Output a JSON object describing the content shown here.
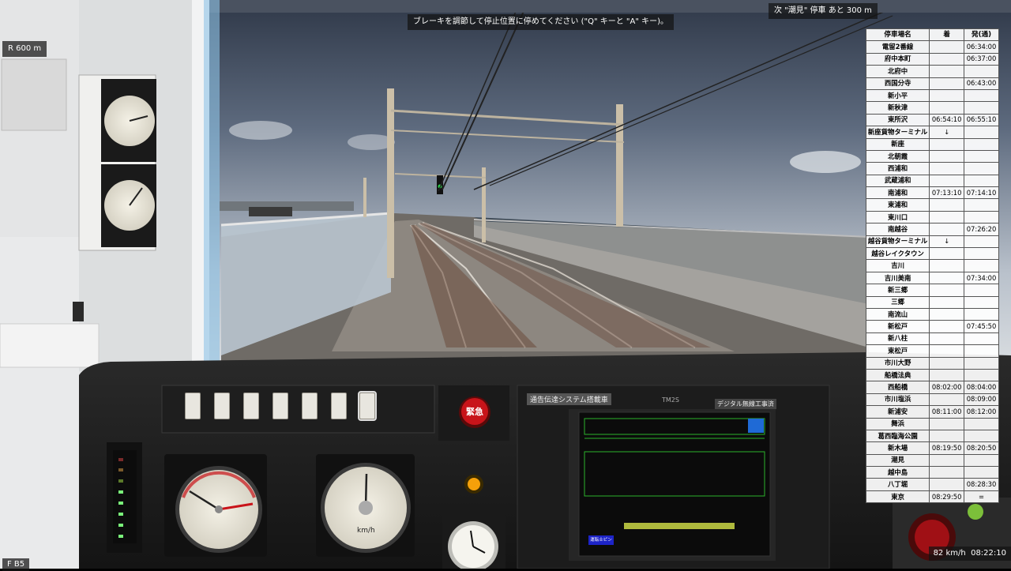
{
  "hud": {
    "curve_radius": "R 600 m",
    "brake_hint": "ブレーキを調節して停止位置に停めてください (\"Q\" キーと \"A\" キー)。",
    "next_stop": "次 \"潮見\" 停車 あと 300 m",
    "notch": "F B5",
    "speed": "82 km/h",
    "clock": "08:22:10"
  },
  "timetable": {
    "headers": [
      "停車場名",
      "着",
      "発(通)"
    ],
    "rows": [
      [
        "電留2番線",
        "",
        "06:34:00"
      ],
      [
        "府中本町",
        "",
        "06:37:00"
      ],
      [
        "北府中",
        "",
        ""
      ],
      [
        "西国分寺",
        "",
        "06:43:00"
      ],
      [
        "新小平",
        "",
        ""
      ],
      [
        "新秋津",
        "",
        ""
      ],
      [
        "東所沢",
        "06:54:10",
        "06:55:10"
      ],
      [
        "新座貨物ターミナル",
        "↓",
        ""
      ],
      [
        "新座",
        "",
        ""
      ],
      [
        "北朝霞",
        "",
        ""
      ],
      [
        "西浦和",
        "",
        ""
      ],
      [
        "武蔵浦和",
        "",
        ""
      ],
      [
        "南浦和",
        "07:13:10",
        "07:14:10"
      ],
      [
        "東浦和",
        "",
        ""
      ],
      [
        "東川口",
        "",
        ""
      ],
      [
        "南越谷",
        "",
        "07:26:20"
      ],
      [
        "越谷貨物ターミナル",
        "↓",
        ""
      ],
      [
        "越谷レイクタウン",
        "",
        ""
      ],
      [
        "吉川",
        "",
        ""
      ],
      [
        "吉川美南",
        "",
        "07:34:00"
      ],
      [
        "新三郷",
        "",
        ""
      ],
      [
        "三郷",
        "",
        ""
      ],
      [
        "南流山",
        "",
        ""
      ],
      [
        "新松戸",
        "",
        "07:45:50"
      ],
      [
        "新八柱",
        "",
        ""
      ],
      [
        "東松戸",
        "",
        ""
      ],
      [
        "市川大野",
        "",
        ""
      ],
      [
        "船橋法典",
        "",
        ""
      ],
      [
        "西船橋",
        "08:02:00",
        "08:04:00"
      ],
      [
        "市川塩浜",
        "",
        "08:09:00"
      ],
      [
        "新浦安",
        "08:11:00",
        "08:12:00"
      ],
      [
        "舞浜",
        "",
        ""
      ],
      [
        "葛西臨海公園",
        "",
        ""
      ],
      [
        "新木場",
        "08:19:50",
        "08:20:50"
      ],
      [
        "潮見",
        "",
        ""
      ],
      [
        "越中島",
        "",
        ""
      ],
      [
        "八丁堀",
        "",
        "08:28:30"
      ],
      [
        "東京",
        "08:29:50",
        "="
      ]
    ]
  },
  "cab": {
    "emergency_button": "緊急",
    "system_label": "通告伝達システム搭載車",
    "digital_label": "デジタル無線工事済",
    "unit_label": "TM2S",
    "speed_unit": "km/h",
    "monitor_button": "運転士ピン"
  },
  "colors": {
    "sky": "#8fa0b6",
    "timetable_bg": "#ffffff",
    "monitor_green": "#4fd24f",
    "emergency_red": "#c8141a",
    "lamp_orange": "#f5a00a"
  }
}
